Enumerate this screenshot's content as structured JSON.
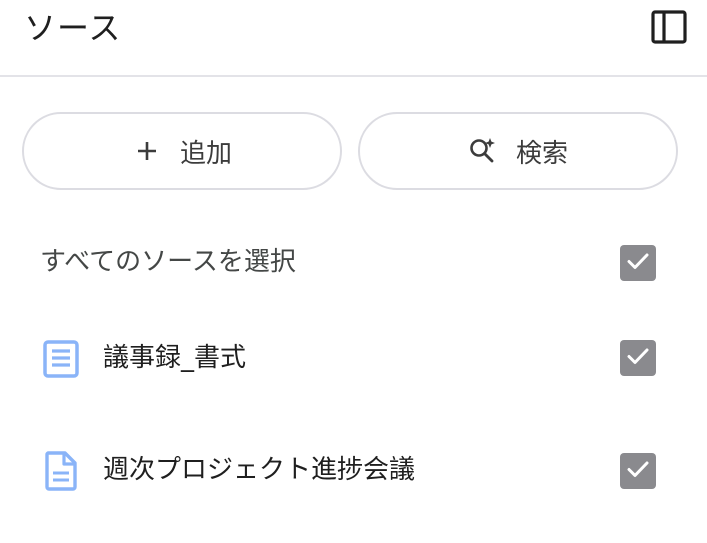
{
  "header": {
    "title": "ソース",
    "panel_toggle_icon": "side-panel-icon"
  },
  "actions": {
    "add_label": "追加",
    "add_icon": "plus-icon",
    "search_label": "検索",
    "search_icon": "sparkle-search-icon"
  },
  "select_all": {
    "label": "すべてのソースを選択",
    "checked": true
  },
  "sources": [
    {
      "label": "議事録_書式",
      "icon": "document-lines-icon",
      "checked": true
    },
    {
      "label": "週次プロジェクト進捗会議",
      "icon": "document-file-icon",
      "checked": true
    }
  ],
  "colors": {
    "checkbox": "#8a8a8e",
    "doc_icon": "#8ab4f8",
    "border": "#dcdce2"
  }
}
